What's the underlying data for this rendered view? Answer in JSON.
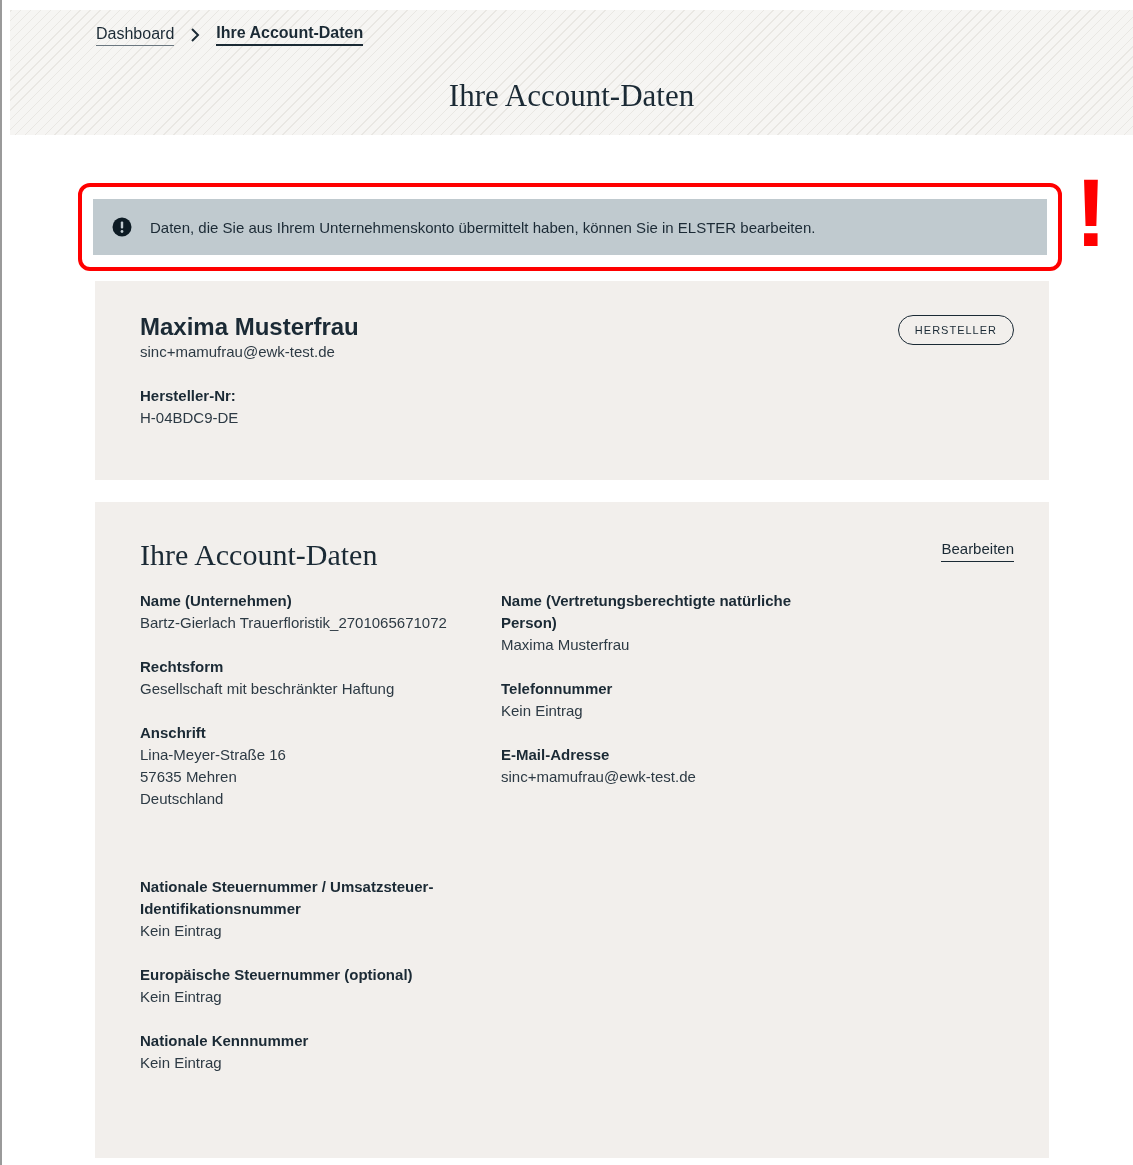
{
  "breadcrumb": [
    {
      "label": "Dashboard",
      "current": false
    },
    {
      "label": "Ihre Account-Daten",
      "current": true
    }
  ],
  "page_title": "Ihre Account-Daten",
  "notice": {
    "text": "Daten, die Sie aus Ihrem Unternehmenskonto übermittelt haben, können Sie in ELSTER bearbeiten.",
    "annotation_mark": "!"
  },
  "profile": {
    "name": "Maxima Musterfrau",
    "email": "sinc+mamufrau@ewk-test.de",
    "role_badge": "HERSTELLER",
    "fields": [
      {
        "label": "Hersteller-Nr:",
        "values": [
          "H-04BDC9-DE"
        ]
      }
    ]
  },
  "account": {
    "title": "Ihre Account-Daten",
    "edit_link": "Bearbeiten",
    "columns": [
      [
        {
          "label": "Name (Unternehmen)",
          "values": [
            "Bartz-Gierlach Trauerfloristik_2701065671072"
          ]
        },
        {
          "label": "Rechtsform",
          "values": [
            "Gesellschaft mit beschränkter Haftung"
          ]
        },
        {
          "label": "Anschrift",
          "values": [
            "Lina-Meyer-Straße 16",
            "57635 Mehren",
            "Deutschland"
          ]
        }
      ],
      [
        {
          "label": "Name (Vertretungsberechtigte natürliche Person)",
          "values": [
            "Maxima Musterfrau"
          ]
        },
        {
          "label": "Telefonnummer",
          "values": [
            "Kein Eintrag"
          ]
        },
        {
          "label": "E-Mail-Adresse",
          "values": [
            "sinc+mamufrau@ewk-test.de"
          ]
        }
      ]
    ],
    "extra_fields": [
      {
        "label": "Nationale Steuernummer / Umsatzsteuer-Identifikationsnummer",
        "values": [
          "Kein Eintrag"
        ]
      },
      {
        "label": "Europäische Steuernummer (optional)",
        "values": [
          "Kein Eintrag"
        ]
      },
      {
        "label": "Nationale Kennnummer",
        "values": [
          "Kein Eintrag"
        ]
      }
    ]
  }
}
